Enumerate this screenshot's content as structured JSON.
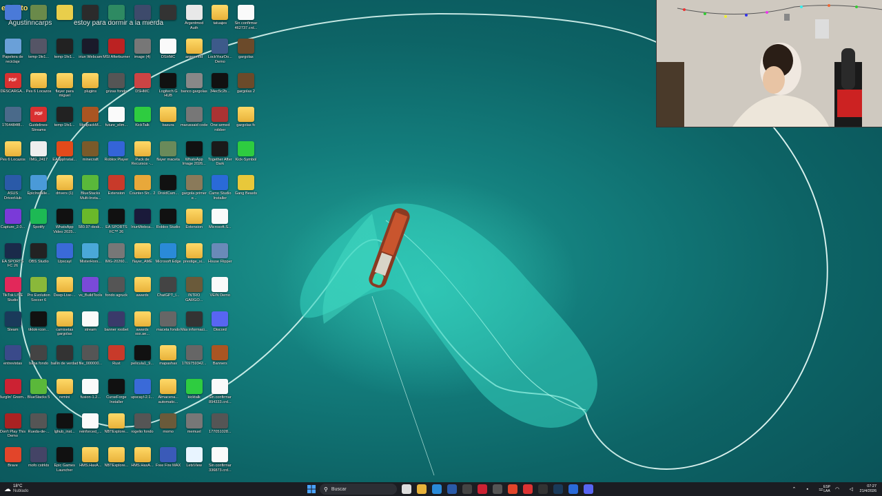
{
  "desktop": {
    "overlay": {
      "streamer_tag": "egksito",
      "user_tag": "Agustinncarps",
      "message": "estoy para dormir a la mierda"
    },
    "icons": [
      {
        "label": "",
        "col": 0,
        "row": 0,
        "kind": "img",
        "color": "#4a7ad8"
      },
      {
        "label": "",
        "col": 1,
        "row": 0,
        "kind": "img",
        "color": "#6a8a4a"
      },
      {
        "label": "",
        "col": 2,
        "row": 0,
        "kind": "img",
        "color": "#e9ce4b"
      },
      {
        "label": "",
        "col": 3,
        "row": 0,
        "kind": "img",
        "color": "#2b2b2b"
      },
      {
        "label": "",
        "col": 4,
        "row": 0,
        "kind": "img",
        "color": "#2e8a62"
      },
      {
        "label": "",
        "col": 5,
        "row": 0,
        "kind": "exe",
        "color": "#3d4a6b"
      },
      {
        "label": "",
        "col": 6,
        "row": 0,
        "kind": "img",
        "color": "#333"
      },
      {
        "label": "Argentmod Auth",
        "col": 7,
        "row": 0,
        "kind": "exe",
        "color": "#e8e8e8"
      },
      {
        "label": "tatuajes",
        "col": 8,
        "row": 0,
        "kind": "folder",
        "color": "#e8b23a"
      },
      {
        "label": "Sin confirmar 462737.crd...",
        "col": 9,
        "row": 0,
        "kind": "doc",
        "color": "#fff"
      },
      {
        "label": "Papelera de reciclaje",
        "col": 0,
        "row": 1,
        "kind": "exe",
        "color": "#6aa0d8"
      },
      {
        "label": "temp-1fe1...",
        "col": 1,
        "row": 1,
        "kind": "img",
        "color": "#556"
      },
      {
        "label": "temp-1fe1...",
        "col": 2,
        "row": 1,
        "kind": "dark",
        "color": "#222"
      },
      {
        "label": "iriun Webcam",
        "col": 3,
        "row": 1,
        "kind": "exe",
        "color": "#1a1a2a"
      },
      {
        "label": "MSI Afterburner",
        "col": 4,
        "row": 1,
        "kind": "exe",
        "color": "#b22"
      },
      {
        "label": "image (4)",
        "col": 5,
        "row": 1,
        "kind": "img",
        "color": "#777"
      },
      {
        "label": "DSHMC",
        "col": 6,
        "row": 1,
        "kind": "doc",
        "color": "#fff"
      },
      {
        "label": "argenmod",
        "col": 7,
        "row": 1,
        "kind": "folder",
        "color": "#e8b23a"
      },
      {
        "label": "LockYourDo... Demo",
        "col": 8,
        "row": 1,
        "kind": "exe",
        "color": "#3d5a8a"
      },
      {
        "label": "gargolas",
        "col": 9,
        "row": 1,
        "kind": "exe",
        "color": "#6b4a2a"
      },
      {
        "label": "DESCARGA...",
        "col": 0,
        "row": 2,
        "kind": "pdf",
        "color": "#d93131"
      },
      {
        "label": "Pes 6 Locazos",
        "col": 1,
        "row": 2,
        "kind": "folder",
        "color": "#e8b23a"
      },
      {
        "label": "flayer para miguel",
        "col": 2,
        "row": 2,
        "kind": "folder",
        "color": "#e8b23a"
      },
      {
        "label": "plugins",
        "col": 3,
        "row": 2,
        "kind": "folder",
        "color": "#e8b23a"
      },
      {
        "label": "grizas fondo",
        "col": 4,
        "row": 2,
        "kind": "img",
        "color": "#555"
      },
      {
        "label": "DSHMC",
        "col": 5,
        "row": 2,
        "kind": "exe",
        "color": "#c44"
      },
      {
        "label": "Logitech G HUB",
        "col": 6,
        "row": 2,
        "kind": "exe",
        "color": "#111"
      },
      {
        "label": "banco gargolas",
        "col": 7,
        "row": 2,
        "kind": "img",
        "color": "#888"
      },
      {
        "label": "34ec5c2b...",
        "col": 8,
        "row": 2,
        "kind": "dark",
        "color": "#111"
      },
      {
        "label": "gargolas 2",
        "col": 9,
        "row": 2,
        "kind": "exe",
        "color": "#6b4a2a"
      },
      {
        "label": "1764484f8...",
        "col": 0,
        "row": 3,
        "kind": "img",
        "color": "#4a6a8a"
      },
      {
        "label": "Guidelines-Streams",
        "col": 1,
        "row": 3,
        "kind": "pdf",
        "color": "#d93131"
      },
      {
        "label": "temp-1fe1...",
        "col": 2,
        "row": 3,
        "kind": "dark",
        "color": "#222"
      },
      {
        "label": "ModpackM...",
        "col": 3,
        "row": 3,
        "kind": "exe",
        "color": "#a52"
      },
      {
        "label": "future_elim...",
        "col": 4,
        "row": 3,
        "kind": "doc",
        "color": "#fff"
      },
      {
        "label": "KickTalk",
        "col": 5,
        "row": 3,
        "kind": "exe",
        "color": "#2ecc40"
      },
      {
        "label": "basura",
        "col": 6,
        "row": 3,
        "kind": "folder",
        "color": "#e8b23a"
      },
      {
        "label": "marussaid code",
        "col": 7,
        "row": 3,
        "kind": "img",
        "color": "#777"
      },
      {
        "label": "One-armed robber",
        "col": 8,
        "row": 3,
        "kind": "exe",
        "color": "#a33"
      },
      {
        "label": "gargolas fc",
        "col": 9,
        "row": 3,
        "kind": "folder",
        "color": "#e8b23a"
      },
      {
        "label": "Pes 6 Locazos",
        "col": 0,
        "row": 4,
        "kind": "folder",
        "color": "#e8b23a"
      },
      {
        "label": "IMG_2417",
        "col": 1,
        "row": 4,
        "kind": "img",
        "color": "#eee"
      },
      {
        "label": "EAappInstal...",
        "col": 2,
        "row": 4,
        "kind": "exe",
        "color": "#e24a1a"
      },
      {
        "label": "minecraft",
        "col": 3,
        "row": 4,
        "kind": "img",
        "color": "#7a5a2a"
      },
      {
        "label": "Roblox Player",
        "col": 4,
        "row": 4,
        "kind": "exe",
        "color": "#3464d8"
      },
      {
        "label": "Pack de Recursos -...",
        "col": 5,
        "row": 4,
        "kind": "folder",
        "color": "#e8b23a"
      },
      {
        "label": "flayer maceta",
        "col": 6,
        "row": 4,
        "kind": "img",
        "color": "#6a8a5a"
      },
      {
        "label": "WhatsApp Image 2026...",
        "col": 7,
        "row": 4,
        "kind": "dark",
        "color": "#111"
      },
      {
        "label": "Together After Dark",
        "col": 8,
        "row": 4,
        "kind": "exe",
        "color": "#1a1a1a"
      },
      {
        "label": "Kick-Symbol",
        "col": 9,
        "row": 4,
        "kind": "exe",
        "color": "#2ecc40"
      },
      {
        "label": "ASUS DriverHub",
        "col": 0,
        "row": 5,
        "kind": "exe",
        "color": "#2a5aa8"
      },
      {
        "label": "EpicInstalle...",
        "col": 1,
        "row": 5,
        "kind": "exe",
        "color": "#4a9ad8"
      },
      {
        "label": "drivers (1)",
        "col": 2,
        "row": 5,
        "kind": "folder",
        "color": "#e8b23a"
      },
      {
        "label": "BlueStacks Multi-Insta...",
        "col": 3,
        "row": 5,
        "kind": "exe",
        "color": "#5ab83a"
      },
      {
        "label": "Extension",
        "col": 4,
        "row": 5,
        "kind": "exe",
        "color": "#c83a2a"
      },
      {
        "label": "Counter-Str... 2",
        "col": 5,
        "row": 5,
        "kind": "exe",
        "color": "#e8a83a"
      },
      {
        "label": "DroidCam...",
        "col": 6,
        "row": 5,
        "kind": "exe",
        "color": "#111"
      },
      {
        "label": "gargola primer e...",
        "col": 7,
        "row": 5,
        "kind": "img",
        "color": "#8a7a5a"
      },
      {
        "label": "Camo Studio Installer",
        "col": 8,
        "row": 5,
        "kind": "exe",
        "color": "#2a6ad8"
      },
      {
        "label": "Gang Beasts",
        "col": 9,
        "row": 5,
        "kind": "exe",
        "color": "#e8c83a"
      },
      {
        "label": "Capture_2.0...",
        "col": 0,
        "row": 6,
        "kind": "exe",
        "color": "#7a3ad8"
      },
      {
        "label": "Spotify",
        "col": 1,
        "row": 6,
        "kind": "exe",
        "color": "#1db954"
      },
      {
        "label": "WhatsApp Video 2025...",
        "col": 2,
        "row": 6,
        "kind": "dark",
        "color": "#111"
      },
      {
        "label": "580.97-desk...",
        "col": 3,
        "row": 6,
        "kind": "exe",
        "color": "#6ab82a"
      },
      {
        "label": "EA SPORTS FC™ 26",
        "col": 4,
        "row": 6,
        "kind": "exe",
        "color": "#111"
      },
      {
        "label": "IriunWebca...",
        "col": 5,
        "row": 6,
        "kind": "exe",
        "color": "#1a1a3a"
      },
      {
        "label": "Roblox Studio",
        "col": 6,
        "row": 6,
        "kind": "exe",
        "color": "#111"
      },
      {
        "label": "Extension",
        "col": 7,
        "row": 6,
        "kind": "folder",
        "color": "#e8b23a"
      },
      {
        "label": "Microsoft.S...",
        "col": 8,
        "row": 6,
        "kind": "doc",
        "color": "#fff"
      },
      {
        "label": "EA SPORTS FC 26",
        "col": 0,
        "row": 7,
        "kind": "exe",
        "color": "#1a2a4a"
      },
      {
        "label": "OBS Studio",
        "col": 1,
        "row": 7,
        "kind": "exe",
        "color": "#222"
      },
      {
        "label": "Upscayl",
        "col": 2,
        "row": 7,
        "kind": "exe",
        "color": "#3a6ad8"
      },
      {
        "label": "MisterHors...",
        "col": 3,
        "row": 7,
        "kind": "exe",
        "color": "#4aa8d8"
      },
      {
        "label": "IMG-20260...",
        "col": 4,
        "row": 7,
        "kind": "img",
        "color": "#777"
      },
      {
        "label": "flayer_AME",
        "col": 5,
        "row": 7,
        "kind": "folder",
        "color": "#e8b23a"
      },
      {
        "label": "Microsoft Edge",
        "col": 6,
        "row": 7,
        "kind": "exe",
        "color": "#2a8ad8"
      },
      {
        "label": "prestige_si...",
        "col": 7,
        "row": 7,
        "kind": "folder",
        "color": "#e8b23a"
      },
      {
        "label": "House Flipper",
        "col": 8,
        "row": 7,
        "kind": "exe",
        "color": "#6a8ab8"
      },
      {
        "label": "TikTok LIVE Studio",
        "col": 0,
        "row": 8,
        "kind": "exe",
        "color": "#e2285a"
      },
      {
        "label": "Pro Evolution Soccer 6",
        "col": 1,
        "row": 8,
        "kind": "exe",
        "color": "#8ab83a"
      },
      {
        "label": "Deep-Live-...",
        "col": 2,
        "row": 8,
        "kind": "folder",
        "color": "#e8b23a"
      },
      {
        "label": "vs_BuildTools",
        "col": 3,
        "row": 8,
        "kind": "exe",
        "color": "#7a4ad8"
      },
      {
        "label": "fondo agruck",
        "col": 4,
        "row": 8,
        "kind": "img",
        "color": "#555"
      },
      {
        "label": "awards",
        "col": 5,
        "row": 8,
        "kind": "folder",
        "color": "#e8b23a"
      },
      {
        "label": "ChatGPT_I...",
        "col": 6,
        "row": 8,
        "kind": "img",
        "color": "#444"
      },
      {
        "label": "INTRO GARGO...",
        "col": 7,
        "row": 8,
        "kind": "img",
        "color": "#6a5a3a"
      },
      {
        "label": "VEIN Demo",
        "col": 8,
        "row": 8,
        "kind": "doc",
        "color": "#fff"
      },
      {
        "label": "Steam",
        "col": 0,
        "row": 9,
        "kind": "exe",
        "color": "#1a3a5a"
      },
      {
        "label": "tiktok-icon...",
        "col": 1,
        "row": 9,
        "kind": "exe",
        "color": "#111"
      },
      {
        "label": "camisetas gargolas",
        "col": 2,
        "row": 9,
        "kind": "folder",
        "color": "#e8b23a"
      },
      {
        "label": "stream",
        "col": 3,
        "row": 9,
        "kind": "doc",
        "color": "#fff"
      },
      {
        "label": "banner roobet",
        "col": 4,
        "row": 9,
        "kind": "img",
        "color": "#3a3a6a"
      },
      {
        "label": "awards sss.ae...",
        "col": 5,
        "row": 9,
        "kind": "folder",
        "color": "#e8b23a"
      },
      {
        "label": "maceta fondo",
        "col": 6,
        "row": 9,
        "kind": "img",
        "color": "#666"
      },
      {
        "label": "Más informaci...",
        "col": 7,
        "row": 9,
        "kind": "exe",
        "color": "#333"
      },
      {
        "label": "Discord",
        "col": 8,
        "row": 9,
        "kind": "exe",
        "color": "#5865f2"
      },
      {
        "label": "entrevistas",
        "col": 0,
        "row": 10,
        "kind": "img",
        "color": "#3a4a8a"
      },
      {
        "label": "bana fondo",
        "col": 1,
        "row": 10,
        "kind": "img",
        "color": "#444"
      },
      {
        "label": "ballin de verdad",
        "col": 2,
        "row": 10,
        "kind": "img",
        "color": "#333"
      },
      {
        "label": "file_000000...",
        "col": 3,
        "row": 10,
        "kind": "img",
        "color": "#555"
      },
      {
        "label": "Rust",
        "col": 4,
        "row": 10,
        "kind": "exe",
        "color": "#c83a2a"
      },
      {
        "label": "pelicula1_9...",
        "col": 5,
        "row": 10,
        "kind": "dark",
        "color": "#111"
      },
      {
        "label": "mapashax",
        "col": 6,
        "row": 10,
        "kind": "folder",
        "color": "#e8b23a"
      },
      {
        "label": "1769759342...",
        "col": 7,
        "row": 10,
        "kind": "img",
        "color": "#666"
      },
      {
        "label": "Banners",
        "col": 8,
        "row": 10,
        "kind": "exe",
        "color": "#a52"
      },
      {
        "label": "Burglin' Gnom...",
        "col": 0,
        "row": 11,
        "kind": "exe",
        "color": "#c23"
      },
      {
        "label": "BlueStacks 5",
        "col": 1,
        "row": 11,
        "kind": "exe",
        "color": "#5ab83a"
      },
      {
        "label": "remini",
        "col": 2,
        "row": 11,
        "kind": "folder",
        "color": "#e8b23a"
      },
      {
        "label": "fusion-1.2...",
        "col": 3,
        "row": 11,
        "kind": "doc",
        "color": "#fff"
      },
      {
        "label": "CurseForge Installer",
        "col": 4,
        "row": 11,
        "kind": "exe",
        "color": "#111"
      },
      {
        "label": "upscayl-2.1...",
        "col": 5,
        "row": 11,
        "kind": "exe",
        "color": "#3a6ad8"
      },
      {
        "label": "Almacena... automatic...",
        "col": 6,
        "row": 11,
        "kind": "folder",
        "color": "#e8b23a"
      },
      {
        "label": "kicktalk",
        "col": 7,
        "row": 11,
        "kind": "exe",
        "color": "#2ecc40"
      },
      {
        "label": "Sin confirmar 894333.crd...",
        "col": 8,
        "row": 11,
        "kind": "doc",
        "color": "#fff"
      },
      {
        "label": "Don't Play This Demo",
        "col": 0,
        "row": 12,
        "kind": "exe",
        "color": "#a22"
      },
      {
        "label": "Rueda-de-...",
        "col": 1,
        "row": 12,
        "kind": "img",
        "color": "#555"
      },
      {
        "label": "lghub_inst...",
        "col": 2,
        "row": 12,
        "kind": "exe",
        "color": "#111"
      },
      {
        "label": "reinforced_...",
        "col": 3,
        "row": 12,
        "kind": "doc",
        "color": "#fff"
      },
      {
        "label": "NBTExplore...",
        "col": 4,
        "row": 12,
        "kind": "folder",
        "color": "#e8b23a"
      },
      {
        "label": "rogelio fondo",
        "col": 5,
        "row": 12,
        "kind": "img",
        "color": "#555"
      },
      {
        "label": "momo",
        "col": 6,
        "row": 12,
        "kind": "img",
        "color": "#6a5a3a"
      },
      {
        "label": "memuel",
        "col": 7,
        "row": 12,
        "kind": "img",
        "color": "#777"
      },
      {
        "label": "177051028...",
        "col": 8,
        "row": 12,
        "kind": "img",
        "color": "#555"
      },
      {
        "label": "Brave",
        "col": 0,
        "row": 13,
        "kind": "exe",
        "color": "#e2452a"
      },
      {
        "label": "mofo cstrkts",
        "col": 1,
        "row": 13,
        "kind": "img",
        "color": "#446"
      },
      {
        "label": "Epic Games Launcher",
        "col": 2,
        "row": 13,
        "kind": "exe",
        "color": "#111"
      },
      {
        "label": "HMS.HaxA...",
        "col": 3,
        "row": 13,
        "kind": "folder",
        "color": "#e8b23a"
      },
      {
        "label": "NBTExplore...",
        "col": 4,
        "row": 13,
        "kind": "folder",
        "color": "#e8b23a"
      },
      {
        "label": "HMS.HaxA...",
        "col": 5,
        "row": 13,
        "kind": "folder",
        "color": "#e8b23a"
      },
      {
        "label": "Free Fire MAX",
        "col": 6,
        "row": 13,
        "kind": "exe",
        "color": "#3a5ab8"
      },
      {
        "label": "LetsView",
        "col": 7,
        "row": 13,
        "kind": "exe",
        "color": "#e8f4ff"
      },
      {
        "label": "Sin confirmar 336873.crd...",
        "col": 8,
        "row": 13,
        "kind": "doc",
        "color": "#fff"
      }
    ]
  },
  "taskbar": {
    "weather_temp": "18°C",
    "weather_desc": "Nublado",
    "search_placeholder": "Buscar",
    "lang_top": "ESP",
    "lang_bottom": "LAA",
    "time": "07:27",
    "date": "21/4/2026",
    "apps": [
      {
        "name": "start",
        "color": "#3a8ae8"
      },
      {
        "name": "task-view",
        "color": "#ddd"
      },
      {
        "name": "file-explorer",
        "color": "#e8b23a"
      },
      {
        "name": "edge",
        "color": "#2a8ad8"
      },
      {
        "name": "app-a",
        "color": "#2a5aa8"
      },
      {
        "name": "app-b",
        "color": "#444"
      },
      {
        "name": "app-c",
        "color": "#c23"
      },
      {
        "name": "app-d",
        "color": "#555"
      },
      {
        "name": "brave",
        "color": "#e2452a"
      },
      {
        "name": "app-e",
        "color": "#d33"
      },
      {
        "name": "app-f",
        "color": "#333"
      },
      {
        "name": "steam",
        "color": "#1a3a5a"
      },
      {
        "name": "app-g",
        "color": "#2a6ad8"
      },
      {
        "name": "discord",
        "color": "#5865f2"
      }
    ]
  }
}
